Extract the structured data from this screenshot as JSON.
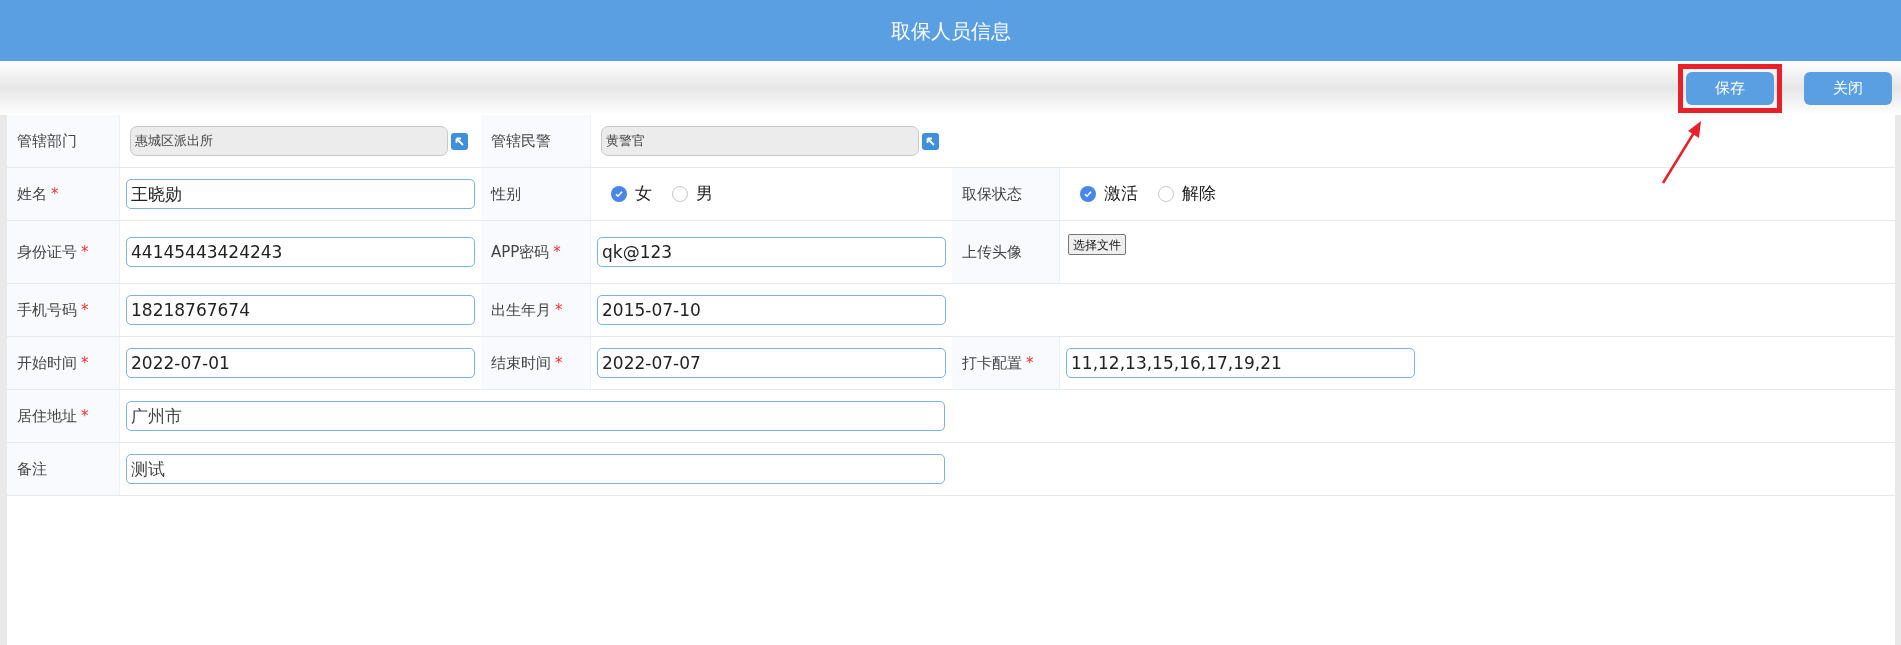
{
  "header": {
    "title": "取保人员信息"
  },
  "toolbar": {
    "buttons": [
      {
        "label": "保存",
        "highlighted": true
      },
      {
        "label": "关闭",
        "highlighted": false
      }
    ]
  },
  "rows": [
    {
      "cells": [
        {
          "kind": "picker",
          "label": "管辖部门",
          "value": "惠城区派出所"
        },
        {
          "kind": "picker",
          "label": "管辖民警",
          "value": "黄警官"
        }
      ]
    },
    {
      "cells": [
        {
          "kind": "text",
          "label": "姓名",
          "required_mark": "*",
          "value": "王晓勋"
        },
        {
          "kind": "radio",
          "label": "性别",
          "options": [
            {
              "label": "女",
              "selected": true
            },
            {
              "label": "男",
              "selected": false
            }
          ]
        },
        {
          "kind": "radio",
          "label": "取保状态",
          "options": [
            {
              "label": "激活",
              "selected": true
            },
            {
              "label": "解除",
              "selected": false
            }
          ]
        }
      ]
    },
    {
      "cells": [
        {
          "kind": "text",
          "label": "身份证号",
          "required_mark": "*",
          "value": "44145443424243"
        },
        {
          "kind": "text",
          "label": "APP密码",
          "required_mark": "*",
          "value": "qk@123"
        },
        {
          "kind": "file",
          "label": "上传头像",
          "button": "选择文件"
        }
      ]
    },
    {
      "cells": [
        {
          "kind": "text",
          "label": "手机号码",
          "required_mark": "*",
          "value": "18218767674"
        },
        {
          "kind": "text",
          "label": "出生年月",
          "required_mark": "*",
          "value": "2015-07-10"
        }
      ]
    },
    {
      "cells": [
        {
          "kind": "text",
          "label": "开始时间",
          "required_mark": "*",
          "value": "2022-07-01"
        },
        {
          "kind": "text",
          "label": "结束时间",
          "required_mark": "*",
          "value": "2022-07-07"
        },
        {
          "kind": "text",
          "label": "打卡配置",
          "required_mark": "*",
          "value": "11,12,13,15,16,17,19,21"
        }
      ]
    },
    {
      "cells": [
        {
          "kind": "wide",
          "label": "居住地址",
          "required_mark": "*",
          "value": "广州市"
        }
      ]
    },
    {
      "cells": [
        {
          "kind": "wide",
          "label": "备注",
          "value": "测试"
        }
      ]
    }
  ]
}
